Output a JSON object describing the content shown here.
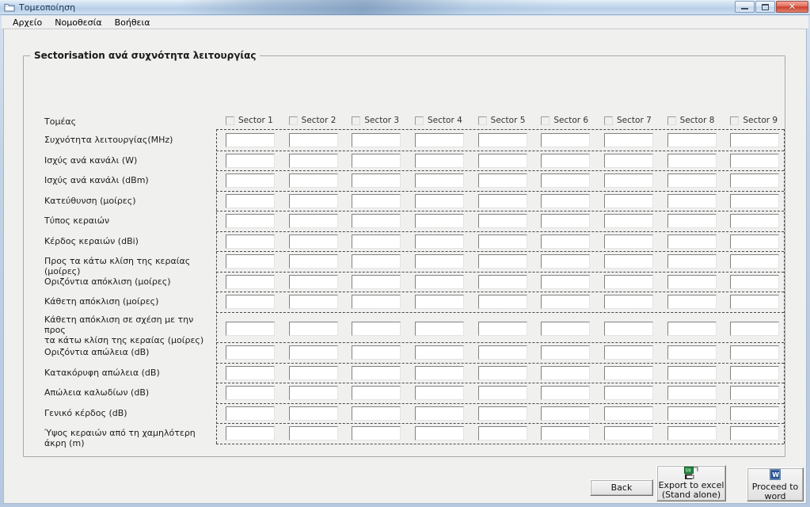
{
  "window": {
    "title": "Τομεοποίηση",
    "icon": "folder-window-icon",
    "minimize_label": "",
    "maximize_label": "",
    "close_label": "✕"
  },
  "menubar": {
    "items": [
      {
        "label": "Αρχείο"
      },
      {
        "label": "Νομοθεσία"
      },
      {
        "label": "Βοήθεια"
      }
    ]
  },
  "groupbox": {
    "legend": "Sectorisation ανά συχνότητα λειτουργίας"
  },
  "grid": {
    "row_labels": [
      "Τομέας",
      "Συχνότητα λειτουργίας(MHz)",
      "Ισχύς ανά κανάλι (W)",
      "Ισχύς ανά κανάλι (dBm)",
      "Κατεύθυνση (μοίρες)",
      "Τύπος κεραιών",
      "Κέρδος κεραιών (dBi)",
      "Προς τα κάτω κλίση της κεραίας (μοίρες)",
      "Οριζόντια απόκλιση (μοίρες)",
      "Κάθετη απόκλιση (μοίρες)",
      "Κάθετη απόκλιση σε σχέση με την προς\nτα κάτω κλίση της κεραίας (μοίρες)",
      "Οριζόντια απώλεια (dB)",
      "Κατακόρυφη απώλεια (dB)",
      "Απώλεια καλωδίων (dB)",
      "Γενικό κέρδος (dB)",
      "Ύψος κεραιών από τη χαμηλότερη άκρη (m)"
    ],
    "columns": [
      {
        "label": "Sector 1",
        "checked": false
      },
      {
        "label": "Sector 2",
        "checked": false
      },
      {
        "label": "Sector 3",
        "checked": false
      },
      {
        "label": "Sector 4",
        "checked": false
      },
      {
        "label": "Sector 5",
        "checked": false
      },
      {
        "label": "Sector 6",
        "checked": false
      },
      {
        "label": "Sector 7",
        "checked": false
      },
      {
        "label": "Sector 8",
        "checked": false
      },
      {
        "label": "Sector 9",
        "checked": false
      }
    ],
    "cell_value": ""
  },
  "footer": {
    "back_label": "Back",
    "export_excel_label": "Export to excel\n(Stand alone)",
    "proceed_word_label": "Proceed to word",
    "excel_icon": "excel-icon",
    "word_icon": "word-icon"
  },
  "colors": {
    "accent": "#c8402c",
    "window_bg": "#f0f0ef",
    "excel_green": "#1f8a3c",
    "word_blue": "#2a5699"
  }
}
